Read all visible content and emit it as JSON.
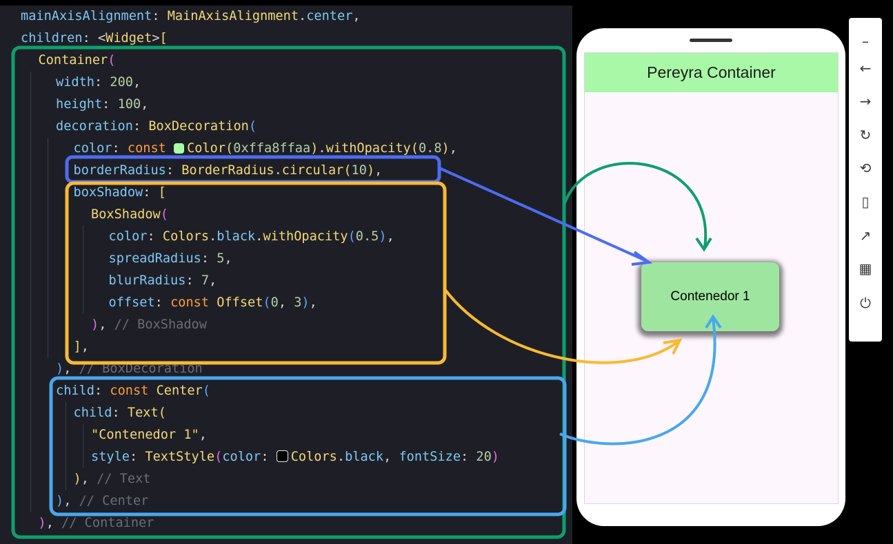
{
  "code": {
    "lines": [
      {
        "indent": 1,
        "tokens": [
          {
            "t": "mainAxisAlignment",
            "c": "prop"
          },
          {
            "t": ": "
          },
          {
            "t": "MainAxisAlignment",
            "c": "cls"
          },
          {
            "t": "."
          },
          {
            "t": "center",
            "c": "prop"
          },
          {
            "t": ","
          }
        ]
      },
      {
        "indent": 1,
        "tokens": [
          {
            "t": "children",
            "c": "prop"
          },
          {
            "t": ": <"
          },
          {
            "t": "Widget",
            "c": "cls"
          },
          {
            "t": ">"
          },
          {
            "t": "[",
            "c": "b1"
          }
        ]
      },
      {
        "indent": 2,
        "tokens": [
          {
            "t": "Container",
            "c": "cls"
          },
          {
            "t": "(",
            "c": "b2"
          }
        ]
      },
      {
        "indent": 3,
        "tokens": [
          {
            "t": "width",
            "c": "prop"
          },
          {
            "t": ": "
          },
          {
            "t": "200",
            "c": "num"
          },
          {
            "t": ","
          }
        ]
      },
      {
        "indent": 3,
        "tokens": [
          {
            "t": "height",
            "c": "prop"
          },
          {
            "t": ": "
          },
          {
            "t": "100",
            "c": "num"
          },
          {
            "t": ","
          }
        ]
      },
      {
        "indent": 3,
        "tokens": [
          {
            "t": "decoration",
            "c": "prop"
          },
          {
            "t": ": "
          },
          {
            "t": "BoxDecoration",
            "c": "cls"
          },
          {
            "t": "(",
            "c": "b3"
          }
        ]
      },
      {
        "indent": 4,
        "tokens": [
          {
            "t": "color",
            "c": "prop"
          },
          {
            "t": ": "
          },
          {
            "t": "const",
            "c": "kw"
          },
          {
            "t": " "
          },
          {
            "swatch": "#a8ffaa"
          },
          {
            "t": "Color",
            "c": "cls"
          },
          {
            "t": "(",
            "c": "b1"
          },
          {
            "t": "0xffa8ffaa",
            "c": "num"
          },
          {
            "t": ")",
            "c": "b1"
          },
          {
            "t": "."
          },
          {
            "t": "withOpacity",
            "c": "fn"
          },
          {
            "t": "(",
            "c": "b1"
          },
          {
            "t": "0.8",
            "c": "num"
          },
          {
            "t": ")",
            "c": "b1"
          },
          {
            "t": ","
          }
        ]
      },
      {
        "indent": 4,
        "tokens": [
          {
            "t": "borderRadius",
            "c": "prop"
          },
          {
            "t": ": "
          },
          {
            "t": "BorderRadius",
            "c": "cls"
          },
          {
            "t": "."
          },
          {
            "t": "circular",
            "c": "fn"
          },
          {
            "t": "(",
            "c": "b1"
          },
          {
            "t": "10",
            "c": "num"
          },
          {
            "t": ")",
            "c": "b1"
          },
          {
            "t": ","
          }
        ]
      },
      {
        "indent": 4,
        "tokens": [
          {
            "t": "boxShadow",
            "c": "prop"
          },
          {
            "t": ": "
          },
          {
            "t": "[",
            "c": "b1"
          }
        ]
      },
      {
        "indent": 5,
        "tokens": [
          {
            "t": "BoxShadow",
            "c": "cls"
          },
          {
            "t": "(",
            "c": "b2"
          }
        ]
      },
      {
        "indent": 6,
        "tokens": [
          {
            "t": "color",
            "c": "prop"
          },
          {
            "t": ": "
          },
          {
            "t": "Colors",
            "c": "cls"
          },
          {
            "t": "."
          },
          {
            "t": "black",
            "c": "prop"
          },
          {
            "t": "."
          },
          {
            "t": "withOpacity",
            "c": "fn"
          },
          {
            "t": "(",
            "c": "b3"
          },
          {
            "t": "0.5",
            "c": "num"
          },
          {
            "t": ")",
            "c": "b3"
          },
          {
            "t": ","
          }
        ]
      },
      {
        "indent": 6,
        "tokens": [
          {
            "t": "spreadRadius",
            "c": "prop"
          },
          {
            "t": ": "
          },
          {
            "t": "5",
            "c": "num"
          },
          {
            "t": ","
          }
        ]
      },
      {
        "indent": 6,
        "tokens": [
          {
            "t": "blurRadius",
            "c": "prop"
          },
          {
            "t": ": "
          },
          {
            "t": "7",
            "c": "num"
          },
          {
            "t": ","
          }
        ]
      },
      {
        "indent": 6,
        "tokens": [
          {
            "t": "offset",
            "c": "prop"
          },
          {
            "t": ": "
          },
          {
            "t": "const",
            "c": "kw"
          },
          {
            "t": " "
          },
          {
            "t": "Offset",
            "c": "cls"
          },
          {
            "t": "(",
            "c": "b3"
          },
          {
            "t": "0",
            "c": "num"
          },
          {
            "t": ", "
          },
          {
            "t": "3",
            "c": "num"
          },
          {
            "t": ")",
            "c": "b3"
          },
          {
            "t": ","
          }
        ]
      },
      {
        "indent": 5,
        "tokens": [
          {
            "t": ")",
            "c": "b2"
          },
          {
            "t": ", "
          },
          {
            "t": "// BoxShadow",
            "c": "cmt"
          }
        ]
      },
      {
        "indent": 4,
        "tokens": [
          {
            "t": "]",
            "c": "b1"
          },
          {
            "t": ","
          }
        ]
      },
      {
        "indent": 3,
        "tokens": [
          {
            "t": ")",
            "c": "b3"
          },
          {
            "t": ", "
          },
          {
            "t": "// BoxDecoration",
            "c": "cmt"
          }
        ]
      },
      {
        "indent": 3,
        "tokens": [
          {
            "t": "child",
            "c": "prop"
          },
          {
            "t": ": "
          },
          {
            "t": "const",
            "c": "kw"
          },
          {
            "t": " "
          },
          {
            "t": "Center",
            "c": "cls"
          },
          {
            "t": "(",
            "c": "b3"
          }
        ]
      },
      {
        "indent": 4,
        "tokens": [
          {
            "t": "child",
            "c": "prop"
          },
          {
            "t": ": "
          },
          {
            "t": "Text",
            "c": "cls"
          },
          {
            "t": "(",
            "c": "b1"
          }
        ]
      },
      {
        "indent": 5,
        "tokens": [
          {
            "t": "\"Contenedor 1\"",
            "c": "str"
          },
          {
            "t": ","
          }
        ]
      },
      {
        "indent": 5,
        "tokens": [
          {
            "t": "style",
            "c": "prop"
          },
          {
            "t": ": "
          },
          {
            "t": "TextStyle",
            "c": "cls"
          },
          {
            "t": "(",
            "c": "b2"
          },
          {
            "t": "color",
            "c": "prop"
          },
          {
            "t": ": "
          },
          {
            "swatch": "#000000"
          },
          {
            "t": "Colors",
            "c": "cls"
          },
          {
            "t": "."
          },
          {
            "t": "black",
            "c": "prop"
          },
          {
            "t": ", "
          },
          {
            "t": "fontSize",
            "c": "prop"
          },
          {
            "t": ": "
          },
          {
            "t": "20",
            "c": "num"
          },
          {
            "t": ")",
            "c": "b2"
          }
        ]
      },
      {
        "indent": 4,
        "tokens": [
          {
            "t": ")",
            "c": "b1"
          },
          {
            "t": ", "
          },
          {
            "t": "// Text",
            "c": "cmt"
          }
        ]
      },
      {
        "indent": 3,
        "tokens": [
          {
            "t": ")",
            "c": "b3"
          },
          {
            "t": ", "
          },
          {
            "t": "// Center",
            "c": "cmt"
          }
        ]
      },
      {
        "indent": 2,
        "tokens": [
          {
            "t": ")",
            "c": "b2"
          },
          {
            "t": ", "
          },
          {
            "t": "// Container",
            "c": "cmt"
          }
        ]
      }
    ]
  },
  "phone": {
    "appbar_title": "Pereyra Container",
    "container_text": "Contenedor 1"
  },
  "toolbar": {
    "buttons": [
      {
        "name": "minimize-icon",
        "glyph": "–"
      },
      {
        "name": "back-arrow-icon",
        "glyph": "←"
      },
      {
        "name": "forward-arrow-icon",
        "glyph": "→"
      },
      {
        "name": "rotate-icon",
        "glyph": "↻"
      },
      {
        "name": "rotate-device-icon",
        "glyph": "⟲"
      },
      {
        "name": "phone-edit-icon",
        "glyph": "▯"
      },
      {
        "name": "open-external-icon",
        "glyph": "↗"
      },
      {
        "name": "qr-code-icon",
        "glyph": "▦"
      },
      {
        "name": "power-icon",
        "glyph": "⏻"
      }
    ]
  },
  "colors": {
    "code_bg": "#1e1f26",
    "green_box": "#0e9f6e",
    "blue_box": "#4d6cf2",
    "yellow_box": "#f9b933",
    "light_blue_box": "#49a7ee"
  }
}
